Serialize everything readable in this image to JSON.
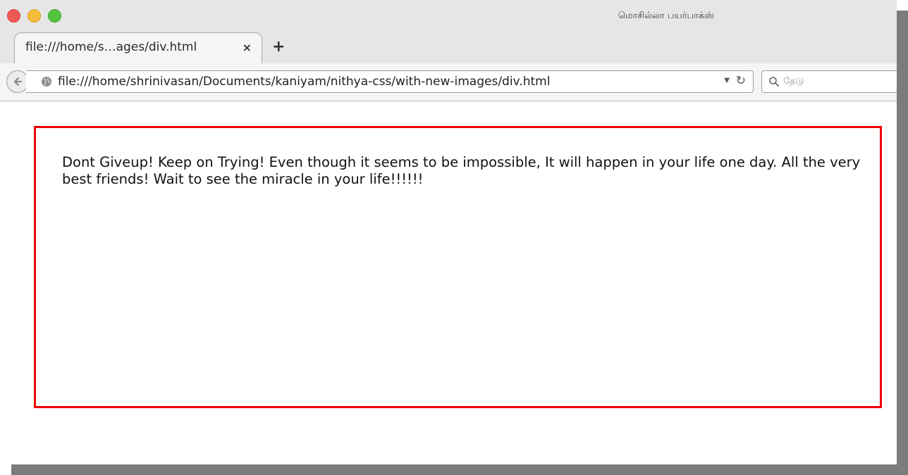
{
  "window": {
    "title": "மொசில்லா பயர்பாக்ஸ்",
    "controls": [
      "close",
      "minimize",
      "maximize"
    ],
    "colors": {
      "close": "#f05a55",
      "minimize": "#f6bd3b",
      "maximize": "#54c43f"
    }
  },
  "tabs": [
    {
      "label": "file:///home/s…ages/div.html",
      "close_icon": "×",
      "active": true
    }
  ],
  "new_tab": {
    "icon": "+"
  },
  "navbar": {
    "back_icon": "back-arrow-icon",
    "url": "file:///home/shrinivasan/Documents/kaniyam/nithya-css/with-new-images/div.html",
    "dropdown_icon": "▼",
    "reload_icon": "↻",
    "search_placeholder": "தேடு"
  },
  "page": {
    "box_border_color": "#ee0000",
    "text": "Dont Giveup! Keep on Trying! Even though it seems to be impossible, It will happen in your life one day. All the very best friends! Wait to see the miracle in your life!!!!!!"
  }
}
